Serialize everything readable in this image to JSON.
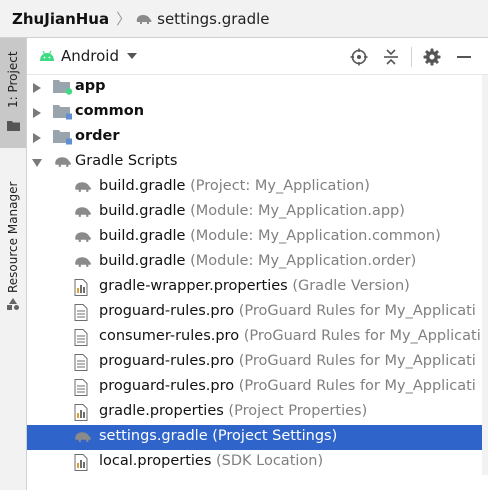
{
  "breadcrumb": {
    "root": "ZhuJianHua",
    "file": "settings.gradle"
  },
  "side_tabs": {
    "project": "1: Project",
    "resource_manager": "Resource Manager"
  },
  "toolbar": {
    "view_label": "Android",
    "icons": [
      "locate-icon",
      "collapse-all-icon",
      "gear-icon",
      "minimize-icon"
    ]
  },
  "tree": {
    "app": "app",
    "common": "common",
    "order": "order",
    "gradle_scripts": "Gradle Scripts",
    "files": [
      {
        "name": "build.gradle",
        "hint": "(Project: My_Application)",
        "icon": "gradle-elephant-icon"
      },
      {
        "name": "build.gradle",
        "hint": "(Module: My_Application.app)",
        "icon": "gradle-elephant-icon"
      },
      {
        "name": "build.gradle",
        "hint": "(Module: My_Application.common)",
        "icon": "gradle-elephant-icon"
      },
      {
        "name": "build.gradle",
        "hint": "(Module: My_Application.order)",
        "icon": "gradle-elephant-icon"
      },
      {
        "name": "gradle-wrapper.properties",
        "hint": "(Gradle Version)",
        "icon": "properties-file-icon"
      },
      {
        "name": "proguard-rules.pro",
        "hint": "(ProGuard Rules for My_Applicati",
        "icon": "text-file-icon"
      },
      {
        "name": "consumer-rules.pro",
        "hint": "(ProGuard Rules for My_Applicati",
        "icon": "text-file-icon"
      },
      {
        "name": "proguard-rules.pro",
        "hint": "(ProGuard Rules for My_Applicati",
        "icon": "text-file-icon"
      },
      {
        "name": "proguard-rules.pro",
        "hint": "(ProGuard Rules for My_Applicati",
        "icon": "text-file-icon"
      },
      {
        "name": "gradle.properties",
        "hint": "(Project Properties)",
        "icon": "properties-file-icon"
      },
      {
        "name": "settings.gradle",
        "hint": "(Project Settings)",
        "icon": "gradle-elephant-icon",
        "selected": true
      },
      {
        "name": "local.properties",
        "hint": "(SDK Location)",
        "icon": "properties-file-icon"
      }
    ]
  },
  "colors": {
    "selection": "#2f65ca",
    "android_green": "#3ddc84",
    "hint_gray": "#808080",
    "sidebar_bg": "#f2f2f2"
  }
}
